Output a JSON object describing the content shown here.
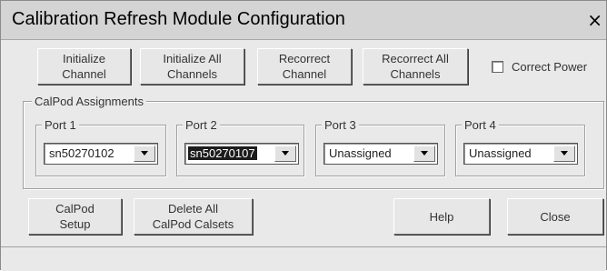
{
  "window": {
    "title": "Calibration Refresh Module Configuration",
    "close_glyph": "×"
  },
  "actions": {
    "initialize_channel": "Initialize\nChannel",
    "initialize_all_channels": "Initialize All\nChannels",
    "recorrect_channel": "Recorrect\nChannel",
    "recorrect_all_channels": "Recorrect All\nChannels",
    "correct_power_label": "Correct Power",
    "correct_power_checked": false
  },
  "assignments": {
    "group_label": "CalPod Assignments",
    "ports": [
      {
        "label": "Port 1",
        "value": "sn50270102",
        "highlighted": false
      },
      {
        "label": "Port 2",
        "value": "sn50270107",
        "highlighted": true
      },
      {
        "label": "Port 3",
        "value": "Unassigned",
        "highlighted": false
      },
      {
        "label": "Port 4",
        "value": "Unassigned",
        "highlighted": false
      }
    ]
  },
  "footer": {
    "calpod_setup": "CalPod\nSetup",
    "delete_all": "Delete All\nCalPod Calsets",
    "help": "Help",
    "close": "Close"
  },
  "icons": {
    "dropdown": "chevron-down-icon",
    "close": "close-icon"
  }
}
